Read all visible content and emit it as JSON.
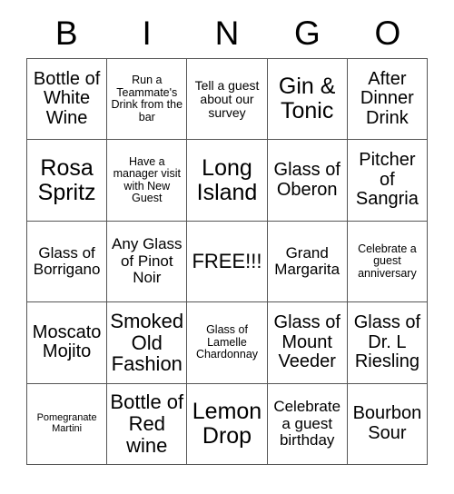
{
  "card": {
    "header": {
      "letters": [
        "B",
        "I",
        "N",
        "G",
        "O"
      ]
    },
    "grid": {
      "columns": 5,
      "rows": 5,
      "border_color": "#555555",
      "background_color": "#ffffff",
      "text_color": "#000000",
      "cells": [
        {
          "text": "Bottle of White Wine",
          "size": "lg"
        },
        {
          "text": "Run a Teammate's Drink from the bar",
          "size": "xs"
        },
        {
          "text": "Tell a guest about our survey",
          "size": "sm"
        },
        {
          "text": "Gin & Tonic",
          "size": "xxl"
        },
        {
          "text": "After Dinner Drink",
          "size": "lg"
        },
        {
          "text": "Rosa Spritz",
          "size": "xxl"
        },
        {
          "text": "Have a manager visit with New Guest",
          "size": "xs"
        },
        {
          "text": "Long Island",
          "size": "xxl"
        },
        {
          "text": "Glass of Oberon",
          "size": "lg"
        },
        {
          "text": "Pitcher of Sangria",
          "size": "lg"
        },
        {
          "text": "Glass of Borrigano",
          "size": "md"
        },
        {
          "text": "Any Glass of Pinot Noir",
          "size": "md"
        },
        {
          "text": "FREE!!!",
          "size": "xl"
        },
        {
          "text": "Grand Margarita",
          "size": "md"
        },
        {
          "text": "Celebrate a guest anniversary",
          "size": "xs"
        },
        {
          "text": "Moscato Mojito",
          "size": "lg"
        },
        {
          "text": "Smoked Old Fashion",
          "size": "xl"
        },
        {
          "text": "Glass of Lamelle Chardonnay",
          "size": "xs"
        },
        {
          "text": "Glass of Mount Veeder",
          "size": "lg"
        },
        {
          "text": "Glass of Dr. L Riesling",
          "size": "lg"
        },
        {
          "text": "Pomegranate Martini",
          "size": "xxs"
        },
        {
          "text": "Bottle of Red wine",
          "size": "xl"
        },
        {
          "text": "Lemon Drop",
          "size": "xxl"
        },
        {
          "text": "Celebrate a guest birthday",
          "size": "md"
        },
        {
          "text": "Bourbon Sour",
          "size": "lg"
        }
      ]
    }
  }
}
